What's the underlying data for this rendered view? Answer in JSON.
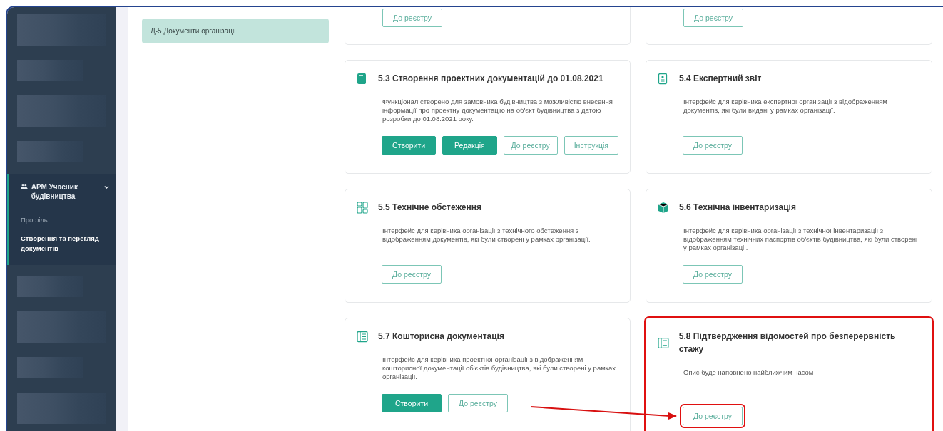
{
  "sidebar": {
    "group": {
      "label": "АРМ Учасник будівництва",
      "expanded": true,
      "items": [
        {
          "label": "Профіль",
          "selected": false
        },
        {
          "label": "Створення та перегляд документів",
          "selected": true
        }
      ]
    }
  },
  "subnav": {
    "items": [
      {
        "label": "Д-5 Документи організації",
        "selected": true
      }
    ]
  },
  "cards": [
    {
      "partial": true,
      "buttons": [
        {
          "label": "До реєстру",
          "kind": "outline",
          "highlighted": false
        }
      ]
    },
    {
      "partial": true,
      "buttons": [
        {
          "label": "До реєстру",
          "kind": "outline",
          "highlighted": false
        }
      ]
    },
    {
      "kind": "file",
      "title": "5.3 Створення проектних документацій до 01.08.2021",
      "description": "Функціонал створено для замовника будівництва з можливістю внесення інформації про проектну документацію на об'єкт будівництва з датою розробки до 01.08.2021 року.",
      "buttons": [
        {
          "label": "Створити",
          "kind": "filled",
          "highlighted": false
        },
        {
          "label": "Редакція",
          "kind": "filled",
          "highlighted": false
        },
        {
          "label": "До реєстру",
          "kind": "outline",
          "highlighted": false
        },
        {
          "label": "Інструкція",
          "kind": "outline",
          "highlighted": false
        }
      ]
    },
    {
      "kind": "badge",
      "title": "5.4 Експертний звіт",
      "description": "Інтерфейс для керівника експертної організації з відображенням документів, які були видані у рамках організації.",
      "buttons": [
        {
          "label": "До реєстру",
          "kind": "outline",
          "highlighted": false
        }
      ]
    },
    {
      "kind": "grid",
      "title": "5.5 Технічне обстеження",
      "description": "Інтерфейс для керівника організації з технічного обстеження з відображенням документів, які були створені у рамках організації.",
      "buttons": [
        {
          "label": "До реєстру",
          "kind": "outline",
          "highlighted": false
        }
      ]
    },
    {
      "kind": "cube",
      "title": "5.6 Технічна інвентаризація",
      "description": "Інтерфейс для керівника організації з технічної інвентаризації з відображенням технічних паспортів об'єктів будівництва, які були створені у рамках організації.",
      "buttons": [
        {
          "label": "До реєстру",
          "kind": "outline",
          "highlighted": false
        }
      ]
    },
    {
      "kind": "list",
      "title": "5.7 Кошторисна документація",
      "description": "Інтерфейс для керівника проектної організації з відображенням кошторисної документації об'єктів будівництва, які були створені у рамках організації.",
      "buttons": [
        {
          "label": "Створити",
          "kind": "filled",
          "highlighted": false
        },
        {
          "label": "До реєстру",
          "kind": "outline",
          "highlighted": false
        }
      ]
    },
    {
      "kind": "list",
      "title": "5.8 Підтвердження відомостей про безперервність стажу",
      "description": "Опис буде наповнено найближчим часом",
      "highlighted": true,
      "buttons": [
        {
          "label": "До реєстру",
          "kind": "outline",
          "highlighted": true
        }
      ]
    }
  ]
}
